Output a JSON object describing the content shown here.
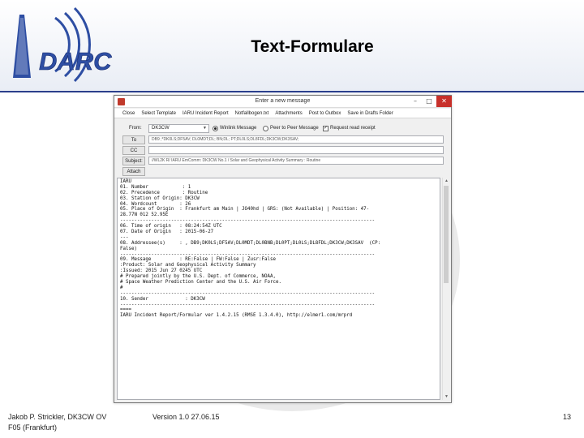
{
  "slide": {
    "title": "Text-Formulare",
    "logo_text": "DARC",
    "logo_ring_text": "DARC",
    "footer_author": "Jakob P. Strickler, DK3CW OV",
    "footer_district": "F05 (Frankfurt)",
    "footer_version": "Version 1.0 27.06.15",
    "page_number": "13"
  },
  "window": {
    "title": "Enter a new message",
    "menu": [
      "Close",
      "Select Template",
      "IARU Incident Report",
      "Notfallbogen.txt",
      "Attachments",
      "Post to Outbox",
      "Save in Drafts Folder"
    ],
    "from_button": "From:",
    "from_value": "DK3CW",
    "to_button": "To",
    "cc_button": "CC",
    "subject_button": "Subject:",
    "attach_button": "Attach",
    "radio_winlink": "Winlink Message",
    "radio_p2p": "Peer to Peer Message",
    "checkbox_receipt": "Request read receipt",
    "to_value": "DB9 ;*DK0LS;DF5AV; DL0MDT;DL; BN;DL; PT;DL0LS;DL8FDL;DK3CW;DK3SAV;",
    "cc_value": "",
    "subject_value": "//WL2K R/ IARU EmComm: DK3CW No.1 / Solar and Geophysical Activity Summary : Routine",
    "message_lines": [
      "IARU",
      "01. Number            : 1",
      "02. Precedence        : Routine",
      "03. Station of Origin: DK3CW",
      "04. Wordcount        : 26",
      "05. Place of Origin  : Frankfurt am Main | JO40hd | GRS: (Not Available) | Position: 47-",
      "28.77N 012 52.95E",
      "------------------------------------------------------------------------------------------",
      "06. Time of origin   : 08:24:54Z UTC",
      "07. Date of Origin   : 2015-06-27",
      "---",
      "08. Addressee(s)     : , DB9;DK0LS;DF5AV;DL0MDT;DL0BNB;DL0PT;DL0LS;DL8FDL;DK3CW;DK3SAV  (CP:",
      "False)",
      "------------------------------------------------------------------------------------------",
      "09. Message          : RE:False | FW:False | Zusr:False",
      ":Product: Solar and Geophysical Activity Summary",
      ":Issued: 2015 Jun 27 0245 UTC",
      "# Prepared jointly by the U.S. Dept. of Commerce, NOAA,",
      "# Space Weather Prediction Center and the U.S. Air Force.",
      "#",
      "------------------------------------------------------------------------------------------",
      "10. Sender             : DK3CW",
      "------------------------------------------------------------------------------------------",
      "====",
      "IARU Incident Report/Formular ver 1.4.2.15 (RMSE 1.3.4.0), http://elmer1.com/mrprd"
    ]
  },
  "colors": {
    "accent": "#2b3f8c",
    "logo_blue": "#2e4ea3",
    "close_red": "#c7302a"
  }
}
